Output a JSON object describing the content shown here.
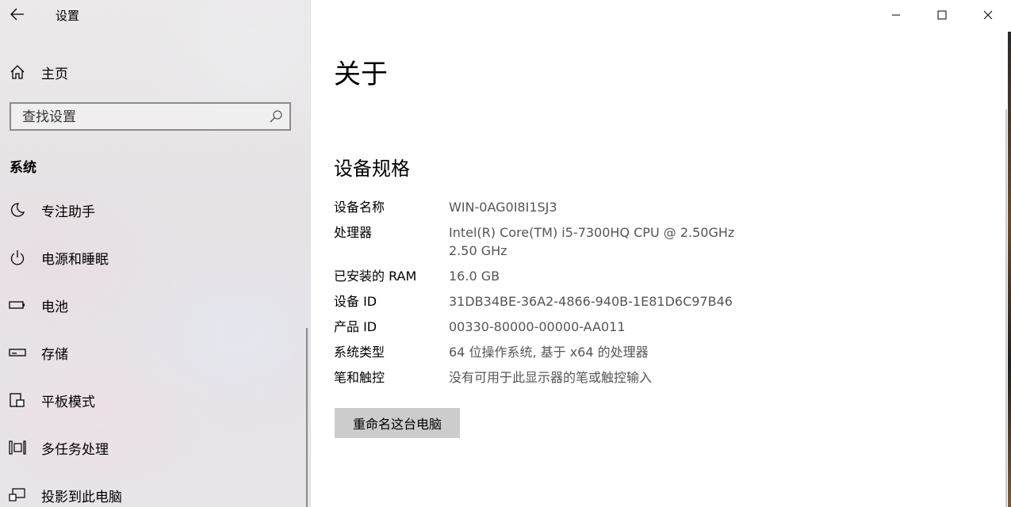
{
  "window": {
    "title": "设置"
  },
  "sidebar": {
    "home_label": "主页",
    "search_placeholder": "查找设置",
    "section_title": "系统",
    "items": [
      {
        "label": "专注助手",
        "icon": "moon-icon"
      },
      {
        "label": "电源和睡眠",
        "icon": "power-icon"
      },
      {
        "label": "电池",
        "icon": "battery-icon"
      },
      {
        "label": "存储",
        "icon": "storage-icon"
      },
      {
        "label": "平板模式",
        "icon": "tablet-mode-icon"
      },
      {
        "label": "多任务处理",
        "icon": "multitasking-icon"
      },
      {
        "label": "投影到此电脑",
        "icon": "project-icon"
      }
    ]
  },
  "main": {
    "title": "关于",
    "spec_title": "设备规格",
    "specs": [
      {
        "key": "设备名称",
        "value": "WIN-0AG0I8I1SJ3"
      },
      {
        "key": "处理器",
        "value": "Intel(R) Core(TM) i5-7300HQ CPU @ 2.50GHz   2.50 GHz"
      },
      {
        "key": "已安装的 RAM",
        "value": "16.0 GB"
      },
      {
        "key": "设备 ID",
        "value": "31DB34BE-36A2-4866-940B-1E81D6C97B46"
      },
      {
        "key": "产品 ID",
        "value": "00330-80000-00000-AA011"
      },
      {
        "key": "系统类型",
        "value": "64 位操作系统, 基于 x64 的处理器"
      },
      {
        "key": "笔和触控",
        "value": "没有可用于此显示器的笔或触控输入"
      }
    ],
    "rename_button": "重命名这台电脑"
  }
}
